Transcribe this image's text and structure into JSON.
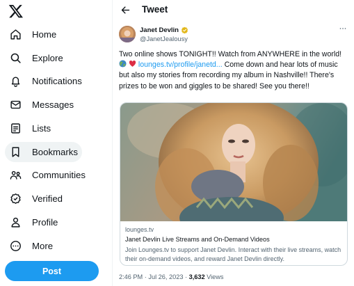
{
  "sidebar": {
    "logo_icon": "x-logo-icon",
    "items": [
      {
        "label": "Home",
        "icon": "home-icon"
      },
      {
        "label": "Explore",
        "icon": "search-icon"
      },
      {
        "label": "Notifications",
        "icon": "bell-icon"
      },
      {
        "label": "Messages",
        "icon": "envelope-icon"
      },
      {
        "label": "Lists",
        "icon": "list-icon"
      },
      {
        "label": "Bookmarks",
        "icon": "bookmark-icon",
        "active": true
      },
      {
        "label": "Communities",
        "icon": "communities-icon"
      },
      {
        "label": "Verified",
        "icon": "verified-badge-icon"
      },
      {
        "label": "Profile",
        "icon": "person-icon"
      },
      {
        "label": "More",
        "icon": "more-circle-icon"
      }
    ],
    "post_label": "Post"
  },
  "header": {
    "title": "Tweet",
    "back_icon": "arrow-left-icon"
  },
  "tweet": {
    "author_name": "Janet Devlin",
    "handle": "@JanetJealousy",
    "text_1": "Two online shows TONIGHT!! Watch from ANYWHERE in the world! ",
    "text_link": "lounges.tv/profile/janetd...",
    "text_2": " Come down and hear lots of music but also my stories from recording my album in Nashville!! There's prizes to be won and giggles to be shared! See you there!!",
    "emojis": [
      "globe-emoji",
      "red-heart-emoji"
    ],
    "card": {
      "domain": "lounges.tv",
      "title": "Janet Devlin Live Streams and On-Demand Videos",
      "description": "Join Lounges.tv to support Janet Devlin. Interact with their live streams, watch their on-demand videos, and reward Janet Devlin directly."
    },
    "timestamp": "2:46 PM · Jul 26, 2023 · ",
    "views_count": "3,632",
    "views_label": " Views"
  },
  "colors": {
    "accent": "#1d9bf0",
    "text": "#0f1419",
    "secondary": "#536471",
    "verified_gold": "#e2b719"
  }
}
